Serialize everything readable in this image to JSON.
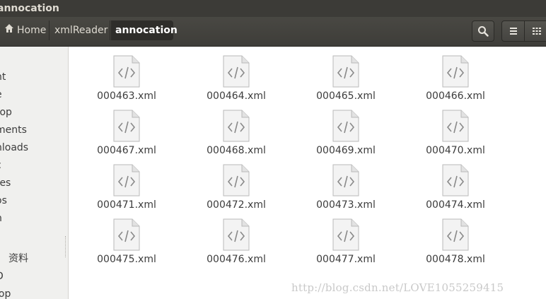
{
  "window": {
    "title": "annocation"
  },
  "breadcrumb": {
    "home": "Home",
    "items": [
      "xmlReader",
      "annocation"
    ]
  },
  "toolbar": {
    "search_icon": "search-icon",
    "list_icon": "list-view-icon",
    "grid_icon": "grid-view-icon"
  },
  "sidebar": {
    "items": [
      "nt",
      "e",
      "top",
      "ments",
      "nloads",
      "c",
      "res",
      "os",
      "n",
      "资料",
      "D",
      "lop"
    ]
  },
  "files": [
    "000463.xml",
    "000464.xml",
    "000465.xml",
    "000466.xml",
    "000467.xml",
    "000468.xml",
    "000469.xml",
    "000470.xml",
    "000471.xml",
    "000472.xml",
    "000473.xml",
    "000474.xml",
    "000475.xml",
    "000476.xml",
    "000477.xml",
    "000478.xml"
  ],
  "watermark": "http://blog.csdn.net/LOVE1055259415",
  "colors": {
    "titlebar": "#3c3b37",
    "headerbar": "#454440",
    "sidebar": "#f0f0ee",
    "text": "#3c3c3c"
  }
}
